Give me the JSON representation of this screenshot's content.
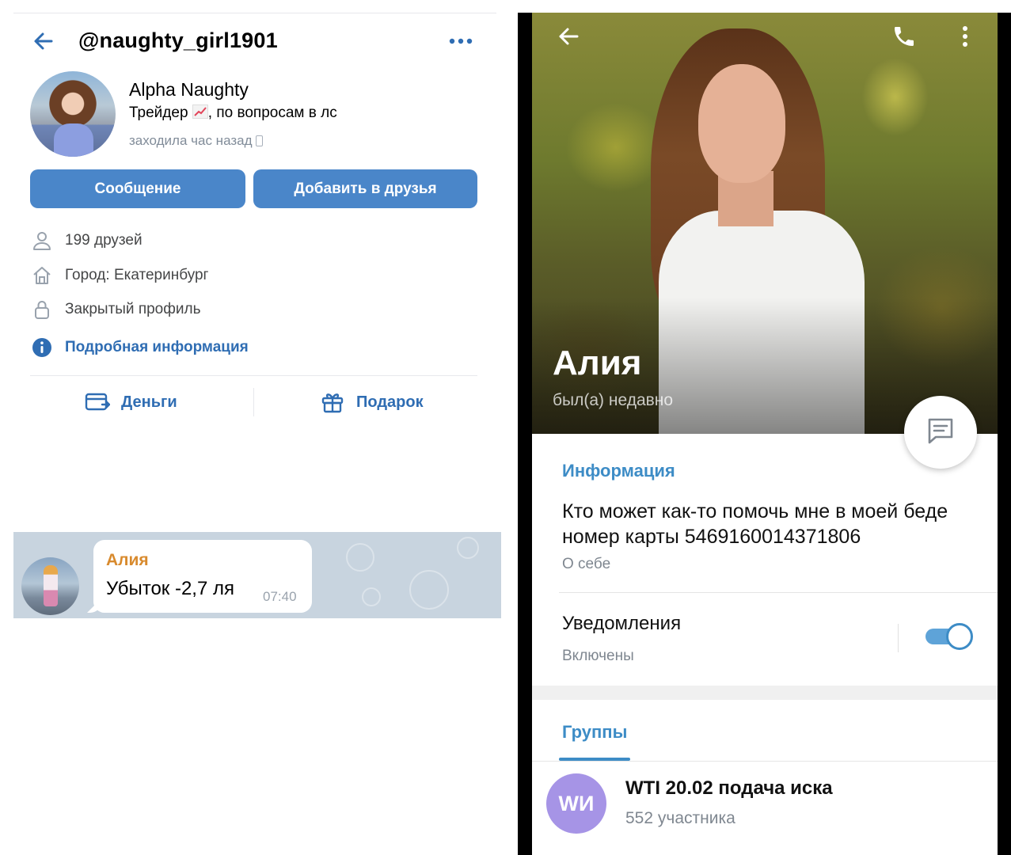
{
  "vk": {
    "handle": "@naughty_girl1901",
    "name": "Alpha Naughty",
    "status_text": "Трейдер , по вопросам в лс",
    "status_before": "Трейдер ",
    "status_after": ", по вопросам в лс",
    "last_seen": "заходила час назад",
    "buttons": {
      "message": "Сообщение",
      "add_friend": "Добавить в друзья"
    },
    "info": {
      "friends": "199 друзей",
      "city": "Город: Екатеринбург",
      "closed": "Закрытый профиль",
      "details": "Подробная информация"
    },
    "actions": {
      "money": "Деньги",
      "gift": "Подарок"
    },
    "icons": [
      "back-arrow-icon",
      "more-icon",
      "person-icon",
      "home-icon",
      "lock-icon",
      "info-icon",
      "card-icon",
      "gift-icon",
      "chart-emoji-icon",
      "phone-icon"
    ],
    "accent_color": "#4a86c9"
  },
  "chat": {
    "sender": "Алия",
    "message": "Убыток -2,7 ля",
    "time": "07:40",
    "sender_color": "#d88a2d"
  },
  "telegram": {
    "name": "Алия",
    "last_seen": "был(а) недавно",
    "info_title": "Информация",
    "about": "Кто может как-то помочь мне в моей беде номер карты 5469160014371806",
    "about_label": "О себе",
    "notifications_title": "Уведомления",
    "notifications_status": "Включены",
    "notifications_enabled": true,
    "groups_tab": "Группы",
    "group": {
      "initials": "WИ",
      "name": "WTI 20.02 подача иска",
      "members": "552 участника"
    },
    "icons": [
      "back-arrow-icon",
      "phone-icon",
      "more-vertical-icon",
      "message-icon"
    ],
    "accent_color": "#3d8cc6"
  }
}
